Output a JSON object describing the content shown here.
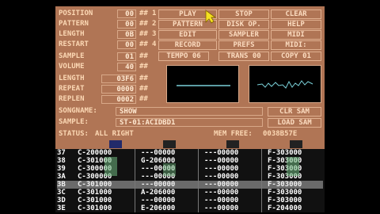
{
  "left_params": [
    {
      "label": "POSITION",
      "value": "00",
      "arrows": "##"
    },
    {
      "label": "PATTERN",
      "value": "00",
      "arrows": "##"
    },
    {
      "label": "LENGTH",
      "value": "0B",
      "arrows": "##"
    },
    {
      "label": "RESTART",
      "value": "00",
      "arrows": "##"
    },
    {
      "label": "SAMPLE",
      "value": "01",
      "arrows": "##"
    },
    {
      "label": "VOLUME",
      "value": "40",
      "arrows": "##"
    },
    {
      "label": "LENGTH",
      "value": "03F6",
      "arrows": "##"
    },
    {
      "label": "REPEAT",
      "value": "0000",
      "arrows": "##"
    },
    {
      "label": "REPLEN",
      "value": "0002",
      "arrows": "##"
    }
  ],
  "buttons": [
    [
      "PLAY",
      "STOP",
      "CLEAR"
    ],
    [
      "PATTERN",
      "DISK OP.",
      "HELP"
    ],
    [
      "EDIT",
      "SAMPLER",
      "MIDI"
    ],
    [
      "RECORD",
      "PREFS",
      "MIDI:"
    ]
  ],
  "digits": [
    "1",
    "2",
    "3",
    "4"
  ],
  "tempo_label": "TEMPO",
  "tempo_value": "06",
  "trans_label": "TRANS",
  "trans_value": "00",
  "copy_label": "COPY",
  "copy_value": "01",
  "songname_label": "SONGNAME:",
  "songname_value": "SHOW",
  "clr_sam": "CLR SAM",
  "sample_label": "SAMPLE:",
  "sample_value": "ST-01:ACIDBD1",
  "load_sam": "LOAD SAM",
  "status_label": "STATUS:",
  "status_value": "ALL  RIGHT",
  "memfree_label": "MEM FREE:",
  "memfree_value": "0038B57E",
  "pattern_rows": [
    {
      "num": "37",
      "tracks": [
        "C-200000",
        "---00000",
        "---00000",
        "F-303000"
      ]
    },
    {
      "num": "38",
      "tracks": [
        "C-301000",
        "G-206000",
        "---00000",
        "F-303000"
      ]
    },
    {
      "num": "39",
      "tracks": [
        "C-300000",
        "---00000",
        "---00000",
        "F-303000"
      ]
    },
    {
      "num": "3A",
      "tracks": [
        "C-300000",
        "---00000",
        "---00000",
        "F-303000"
      ]
    },
    {
      "num": "3B",
      "tracks": [
        "C-301000",
        "---00000",
        "---00000",
        "F-303000"
      ]
    },
    {
      "num": "3C",
      "tracks": [
        "C-301000",
        "A-206000",
        "---00000",
        "F-303000"
      ]
    },
    {
      "num": "3D",
      "tracks": [
        "C-301000",
        "---00000",
        "---00000",
        "F-303000"
      ]
    },
    {
      "num": "3E",
      "tracks": [
        "C-301000",
        "E-206000",
        "---00000",
        "F-204000"
      ]
    }
  ]
}
